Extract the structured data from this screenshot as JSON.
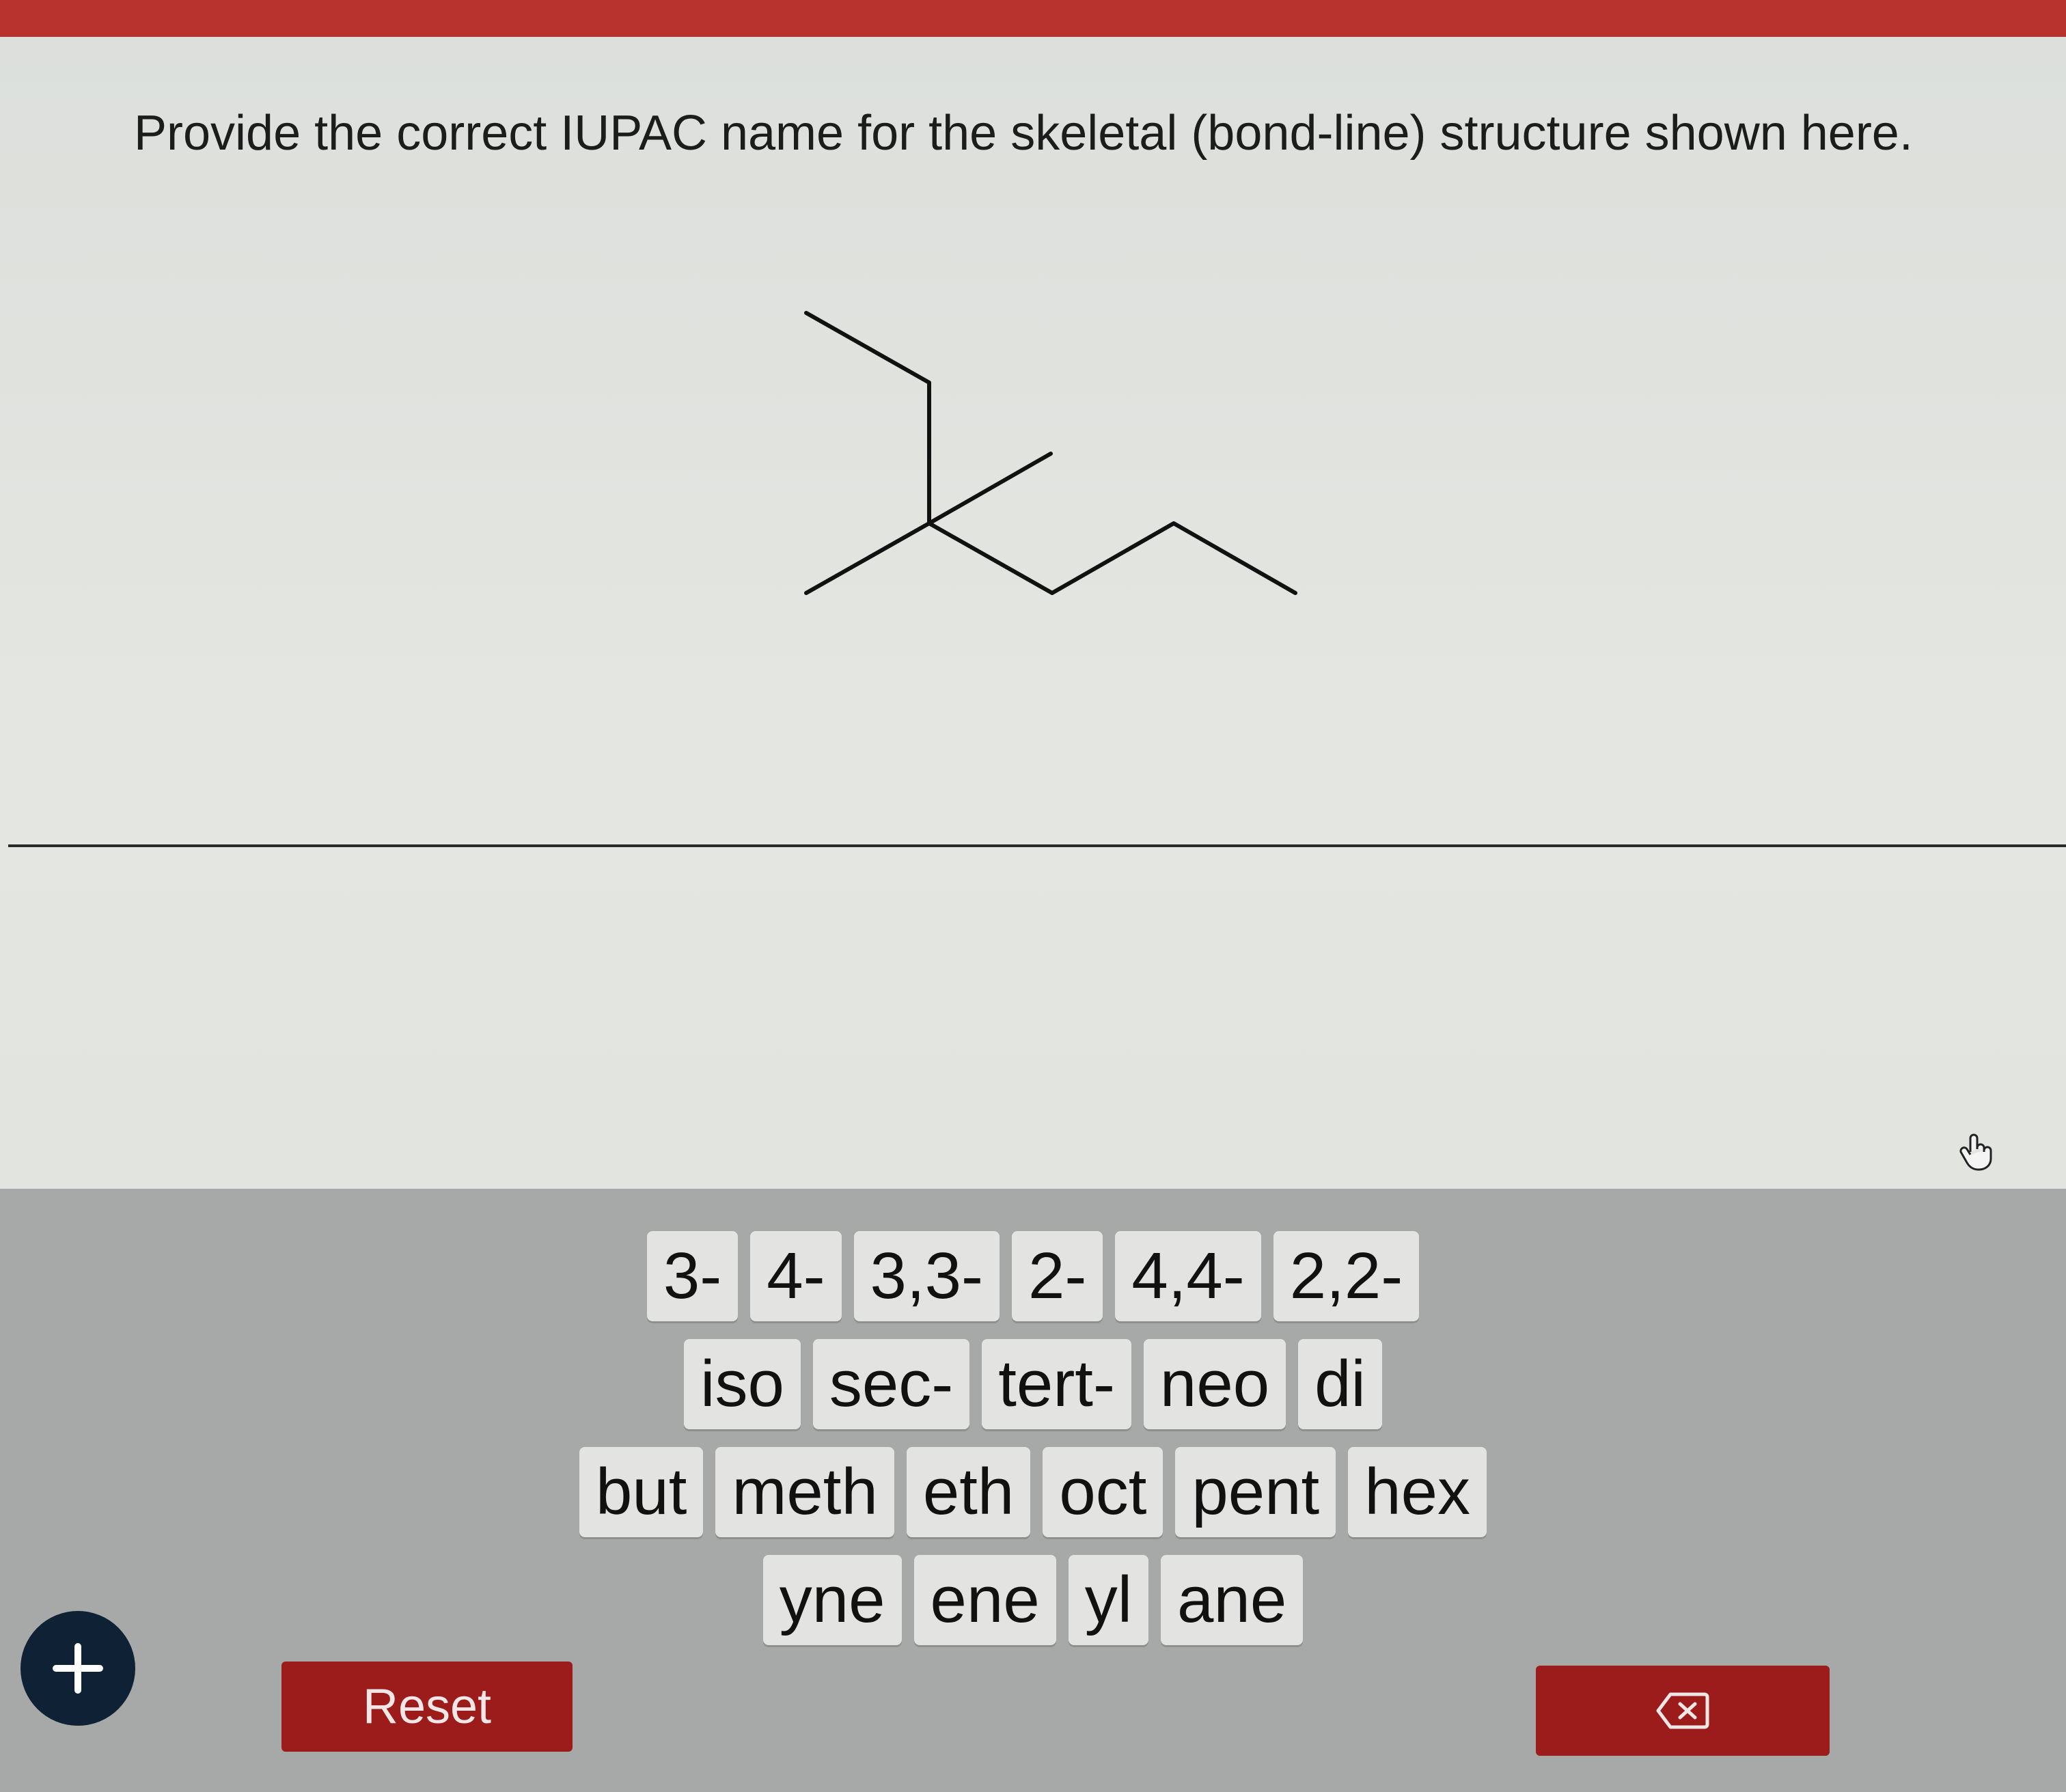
{
  "question": {
    "prompt": "Provide the correct IUPAC name for the skeletal (bond-line) structure shown here."
  },
  "structure_icon": "skeletal-structure",
  "palette": {
    "row1": [
      "3-",
      "4-",
      "3,3-",
      "2-",
      "4,4-",
      "2,2-"
    ],
    "row2": [
      "iso",
      "sec-",
      "tert-",
      "neo",
      "di"
    ],
    "row3": [
      "but",
      "meth",
      "eth",
      "oct",
      "pent",
      "hex"
    ],
    "row4": [
      "yne",
      "ene",
      "yl",
      "ane"
    ]
  },
  "controls": {
    "reset_label": "Reset",
    "plus_icon": "plus-icon",
    "backspace_icon": "backspace-icon"
  },
  "colors": {
    "accent_red": "#9c1c1c",
    "top_bar": "#b8322e",
    "plus_button": "#0f2235",
    "palette_bg": "#a6a9a7",
    "tile_bg": "#e3e4e1"
  }
}
